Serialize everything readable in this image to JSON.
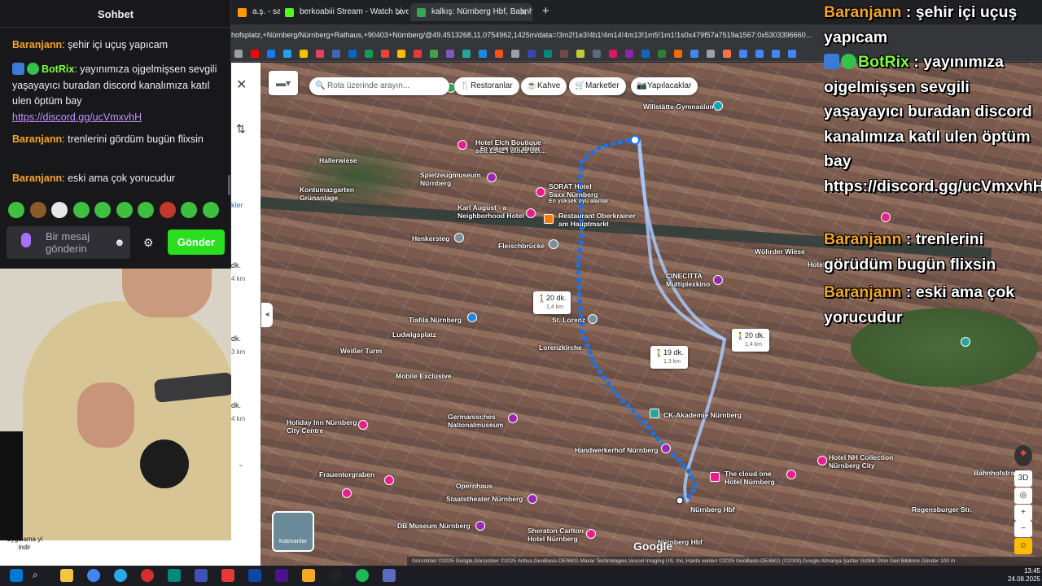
{
  "browser": {
    "tabs": [
      {
        "label": "a.ş. - say",
        "icon_color": "#ff9a00"
      },
      {
        "label": "berkoabiii Stream - Watch Live",
        "icon_color": "#53fc18"
      },
      {
        "label": "kalkış: Nürnberg Hbf, Bahnhofs",
        "icon_color": "#34a853"
      }
    ],
    "new_tab": "+",
    "close_glyph": "✕",
    "url": "hofsplatz,+Nürnberg/Nürnberg+Rathaus,+90403+Nürnberg/@49.4513268,11.0754962,1425m/data=!3m2!1e3!4b1!4m14!4m13!1m5!1m1!1s0x479f57a7519a1567:0x5303396660..."
  },
  "maps": {
    "search_placeholder": "Rota üzerinde arayın...",
    "chips": [
      {
        "label": "Restoranlar",
        "icon": "fork-knife-icon"
      },
      {
        "label": "Kahve",
        "icon": "coffee-icon"
      },
      {
        "label": "Marketler",
        "icon": "cart-icon"
      },
      {
        "label": "Yapılacaklar",
        "icon": "camera-icon"
      }
    ],
    "panel": {
      "close": "✕",
      "swap": "⇅",
      "link_fragment": "kler",
      "routes": [
        {
          "duration": "dk.",
          "distance": "4 km"
        },
        {
          "duration": "dk.",
          "distance": "3 km"
        },
        {
          "duration": "dk.",
          "distance": "4 km"
        }
      ]
    },
    "durations": [
      {
        "time": "20 dk.",
        "distance": "1,4 km"
      },
      {
        "time": "19 dk.",
        "distance": "1,3 km"
      },
      {
        "time": "20 dk.",
        "distance": "1,4 km"
      }
    ],
    "pois": [
      "Willstätte-Gymnasium",
      "Hotel Elch Boutique - seit 1342 / eines der...",
      "Spielzeugmuseum Nürnberg",
      "SORAT Hotel Saxx Nürnberg",
      "Karl August - a Neighborhood Hotel",
      "Restaurant Oberkrainer am Hauptmarkt",
      "Henkersteg",
      "Fleischbrücke",
      "Hallerwiese",
      "Kontumazgarten Grünanlage",
      "CINECITTA Multiplexkino",
      "Tiafila Nürnberg",
      "St. Lorenz",
      "Ludwigsplatz",
      "Weißer Turm",
      "Lorenzkirche",
      "Mobile Exclusive",
      "Germanisches Nationalmuseum",
      "CK-Akademie Nürnberg",
      "Holiday Inn Nürnberg City Centre",
      "Handwerkerhof Nürnberg",
      "Hotel NH Collection Nürnberg City",
      "The cloud one Hotel Nürnberg",
      "Opernhaus",
      "Staatstheater Nürnberg",
      "Nürnberg Hbf",
      "DB Museum Nürnberg",
      "Sheraton Carlton Hotel Nürnberg",
      "Wöhrder Wiese",
      "Hotel Prin",
      "Bahnhofstraße",
      "Regensburger Str.",
      "Frauentorgraben",
      "Nürnberg Hbf"
    ],
    "sponsored": "En yüksek oyu alanlar",
    "layers_label": "Katmanlar",
    "google": "Google",
    "attribution": "Görüntüler ©2025 Google,Görüntüler ©2025 Airbus,GeoBasis-DE/BKG,Maxar Technologies,Vexcel Imaging US, Inc.,Harita verileri ©2025 GeoBasis-DE/BKG (©2009),Google    Almanya    Şartlar    Gizlilik    Ürün Geri Bildirimi Gönder    100 m",
    "controls": [
      "3D",
      "◎",
      "+",
      "−"
    ]
  },
  "chat": {
    "title": "Sohbet",
    "messages": [
      {
        "user": "Baranjann",
        "text": "şehir içi uçuş yapıcam"
      },
      {
        "user": "BotRix",
        "text": "yayınımıza ojgelmişsen sevgili yaşayayıcı buradan discord kanalımıza katıl ulen öptüm bay",
        "link": "https://discord.gg/ucVmxvhH"
      },
      {
        "user": "Baranjann",
        "text": "trenlerini gördüm bugün flixsin"
      },
      {
        "user": "Baranjann",
        "text": "eski ama çok yorucudur"
      }
    ],
    "input_placeholder": "Bir mesaj gönderin",
    "send_label": "Gönder",
    "colors": {
      "user": "#f5a623",
      "bot": "#7cfc3c",
      "send": "#28e01e"
    }
  },
  "cam": {
    "caption": "Uygulama yi indir"
  },
  "overlay": {
    "messages": [
      {
        "user": "Baranjann",
        "sep": " : ",
        "text": "şehir içi uçuş yapıcam"
      },
      {
        "user": "BotRix",
        "sep": " : ",
        "text": "yayınımıza ojgelmişsen sevgili yaşayayıcı buradan discord kanalımıza katıl ulen öptüm bay https://discord.gg/ucVmxvhH"
      },
      {
        "user": "Baranjann",
        "sep": " : ",
        "text": "trenlerini görüdüm bugün flixsin"
      },
      {
        "user": "Baranjann",
        "sep": " : ",
        "text": "eski ama çok yorucudur"
      }
    ]
  },
  "taskbar": {
    "time": "13:45",
    "date": "24.08.2025"
  }
}
